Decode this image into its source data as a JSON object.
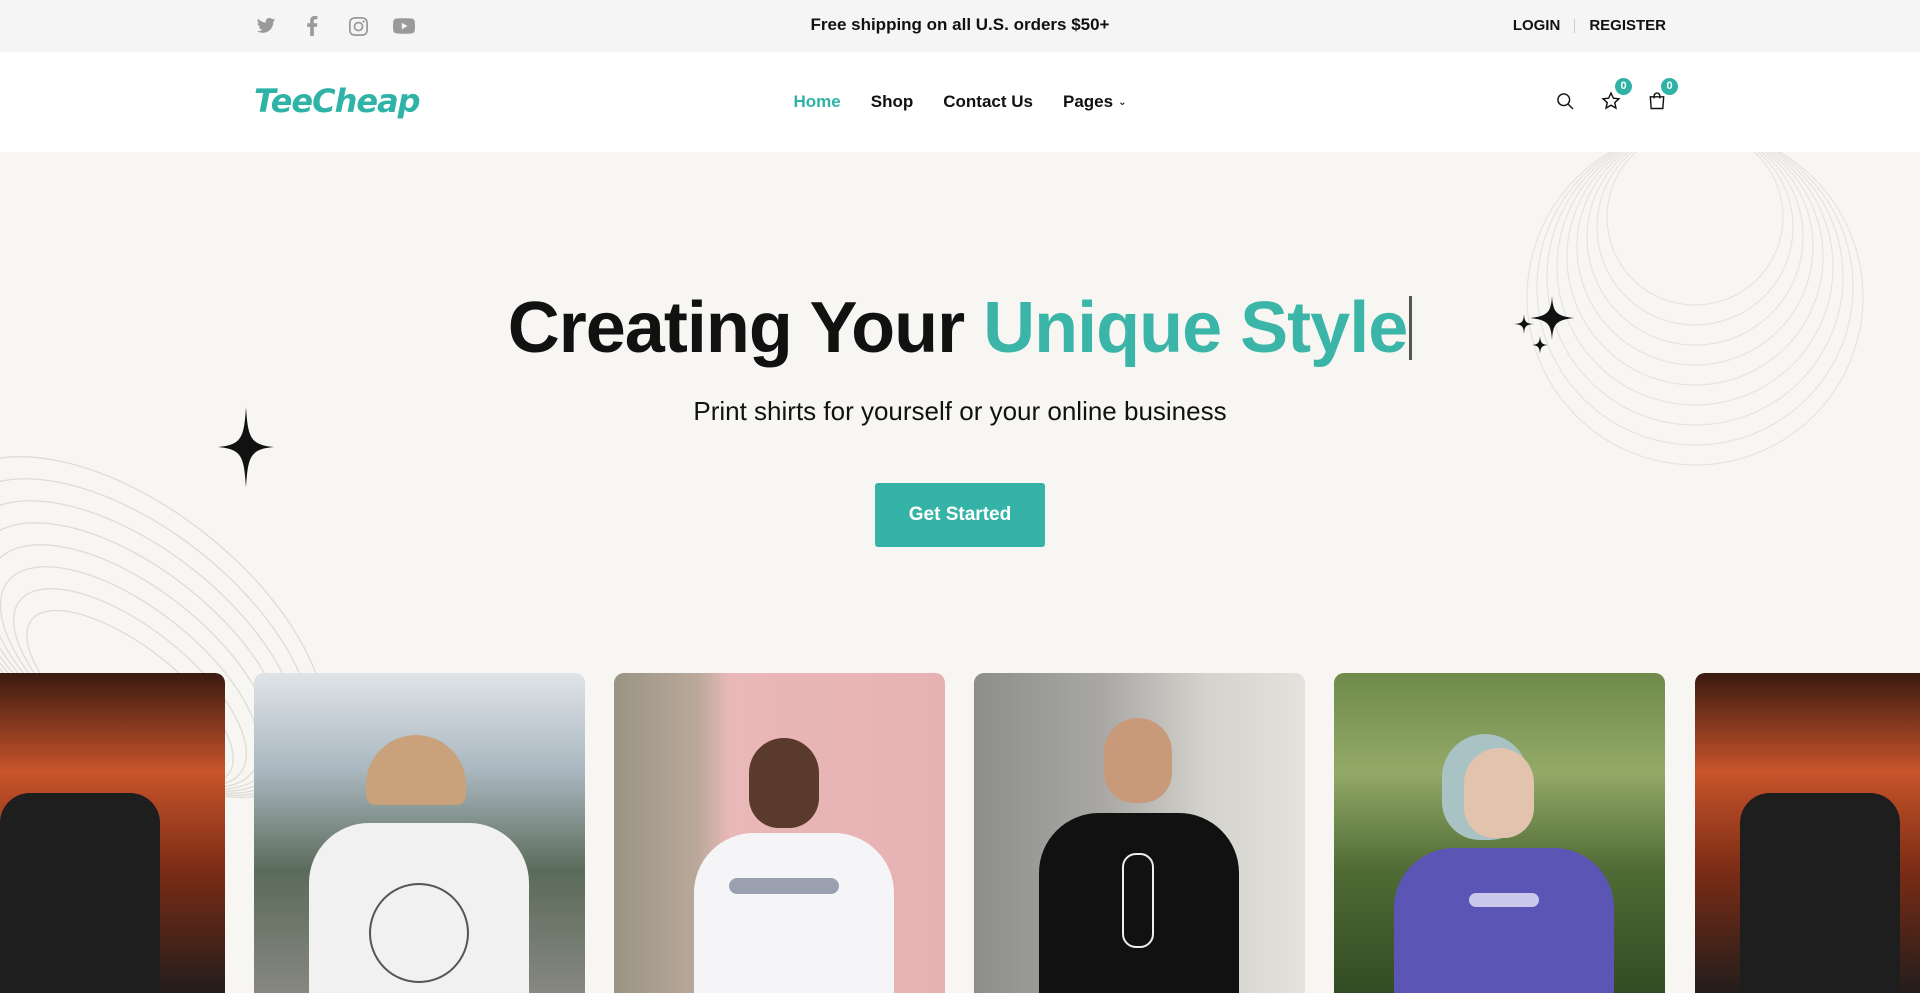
{
  "topbar": {
    "social_icons": [
      "twitter-icon",
      "facebook-icon",
      "instagram-icon",
      "youtube-icon"
    ],
    "promo_text": " Free shipping on all U.S. orders $50+",
    "login_label": "LOGIN",
    "register_label": "REGISTER"
  },
  "header": {
    "logo_text": "TeeCheap",
    "nav": [
      {
        "label": "Home",
        "active": true
      },
      {
        "label": "Shop",
        "active": false
      },
      {
        "label": "Contact Us",
        "active": false
      },
      {
        "label": "Pages",
        "active": false
      }
    ],
    "wishlist_count": "0",
    "cart_count": "0"
  },
  "hero": {
    "headline_prefix": "Creating Your ",
    "headline_accent": "Unique Style",
    "subtitle": "Print shirts for yourself or your online business",
    "cta_label": "Get Started"
  },
  "gallery": [
    {
      "name": "card-torii-partial-left"
    },
    {
      "name": "card-man-cap-back"
    },
    {
      "name": "card-woman-pink-wall"
    },
    {
      "name": "card-man-skeleton-hand"
    },
    {
      "name": "card-woman-purple-shirt"
    },
    {
      "name": "card-torii-partial-right"
    }
  ],
  "colors": {
    "accent": "#2fb3a6",
    "hero_bg": "#f7f6f3",
    "topbar_bg": "#f5f5f5"
  }
}
